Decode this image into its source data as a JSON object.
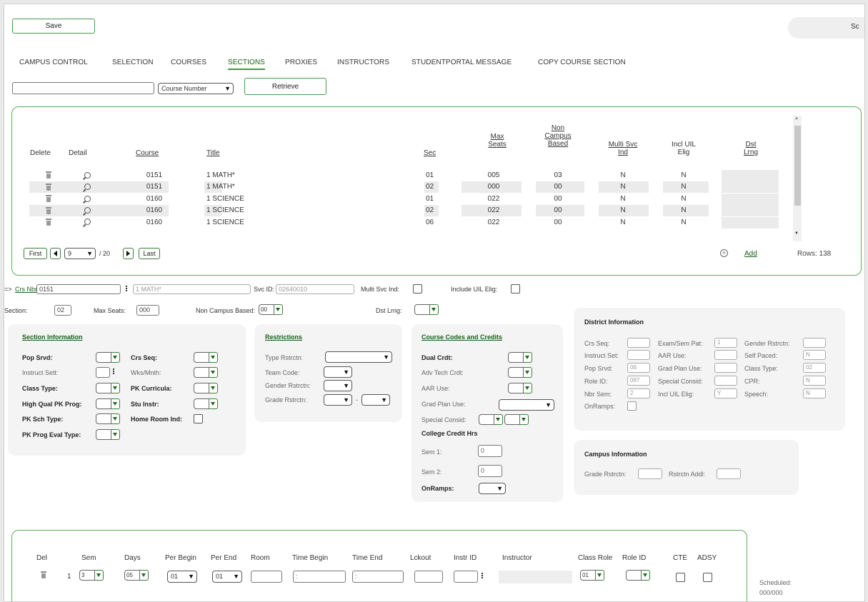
{
  "toolbar": {
    "save_label": "Save",
    "search_partial": "Sc"
  },
  "tabs": [
    {
      "label": "CAMPUS CONTROL"
    },
    {
      "label": "SELECTION"
    },
    {
      "label": "COURSES"
    },
    {
      "label": "SECTIONS"
    },
    {
      "label": "PROXIES"
    },
    {
      "label": "INSTRUCTORS"
    },
    {
      "label": "STUDENTPORTAL MESSAGE"
    },
    {
      "label": "COPY COURSE SECTION"
    }
  ],
  "retrieve": {
    "search_value": "",
    "mode_select": "Course Number",
    "button": "Retrieve"
  },
  "grid": {
    "headers": {
      "delete": "Delete",
      "detail": "Detail",
      "course": "Course",
      "title": "Title",
      "sec": "Sec",
      "max_seats_1": "Max",
      "max_seats_2": "Seats",
      "non_campus_1": "Non",
      "non_campus_2": "Campus",
      "non_campus_3": "Based",
      "multi_svc_1": "Multi Svc",
      "multi_svc_2": "Ind",
      "incl_uil_1": "Incl UIL",
      "incl_uil_2": "Elig",
      "dst_lrng_1": "Dst",
      "dst_lrng_2": "Lrng"
    },
    "rows": [
      {
        "course": "0151",
        "title": "1 MATH*",
        "sec": "01",
        "max_seats": "005",
        "non_campus": "03",
        "multi_svc": "N",
        "incl_uil": "N",
        "dst": ""
      },
      {
        "course": "0151",
        "title": "1 MATH*",
        "sec": "02",
        "max_seats": "000",
        "non_campus": "00",
        "multi_svc": "N",
        "incl_uil": "N",
        "dst": ""
      },
      {
        "course": "0160",
        "title": "1 SCIENCE",
        "sec": "01",
        "max_seats": "022",
        "non_campus": "00",
        "multi_svc": "N",
        "incl_uil": "N",
        "dst": ""
      },
      {
        "course": "0160",
        "title": "1 SCIENCE",
        "sec": "02",
        "max_seats": "022",
        "non_campus": "00",
        "multi_svc": "N",
        "incl_uil": "N",
        "dst": ""
      },
      {
        "course": "0160",
        "title": "1 SCIENCE",
        "sec": "06",
        "max_seats": "022",
        "non_campus": "00",
        "multi_svc": "N",
        "incl_uil": "N",
        "dst": ""
      }
    ],
    "pager": {
      "first": "First",
      "page": "9",
      "total": "/ 20",
      "last": "Last"
    },
    "add_label": "Add",
    "rows_count": "Rows: 138"
  },
  "detail": {
    "arrow": "=>",
    "crs_nbr_label": "Crs Nbr:",
    "crs_nbr_value": "0151",
    "title_value": "1 MATH*",
    "svc_id_label": "Svc ID:",
    "svc_id_value": "02640010",
    "multi_svc_label": "Multi Svc Ind:",
    "include_uil_label": "Include UIL Elig:",
    "section_label": "Section:",
    "section_value": "02",
    "max_seats_label": "Max Seats:",
    "max_seats_value": "000",
    "non_campus_label": "Non Campus Based:",
    "non_campus_value": "00",
    "dst_lrng_label": "Dst Lrng:"
  },
  "section_info": {
    "title": "Section Information",
    "pop_srvd": "Pop Srvd:",
    "instruct_sett": "Instruct Sett:",
    "class_type": "Class Type:",
    "high_qual": "High Qual PK Prog:",
    "pk_sch_type": "PK Sch Type:",
    "pk_prog_eval": "PK Prog Eval Type:",
    "crs_seq": "Crs Seq:",
    "wks_mnth": "Wks/Mnth:",
    "pk_curricula": "PK Curricula:",
    "stu_instr": "Stu Instr:",
    "home_room": "Home Room Ind:"
  },
  "restrictions": {
    "title": "Restrictions",
    "type_rstrctn": "Type Rstrctn:",
    "team_code": "Team Code:",
    "gender_rstrctn": "Gender Rstrctn:",
    "grade_rstrctn": "Grade Rstrctn:",
    "dash": "-"
  },
  "course_codes": {
    "title": "Course Codes and Credits",
    "dual_crdt": "Dual Crdt:",
    "adv_tech": "Adv Tech Crdt:",
    "aar_use": "AAR Use:",
    "grad_plan": "Grad Plan Use:",
    "special_consid": "Special Consid:",
    "college_credit": "College Credit Hrs",
    "sem1_label": "Sem 1:",
    "sem1_value": "0",
    "sem2_label": "Sem 2:",
    "sem2_value": "0",
    "onramps": "OnRamps:"
  },
  "district_info": {
    "title": "District Information",
    "crs_seq": "Crs Seq:",
    "crs_seq_v": "",
    "instruct_set": "Instruct Set:",
    "instruct_set_v": "",
    "pop_srvd": "Pop Srvd:",
    "pop_srvd_v": "06",
    "role_id": "Role ID:",
    "role_id_v": "087",
    "nbr_sem": "Nbr Sem:",
    "nbr_sem_v": "2",
    "onramps": "OnRamps:",
    "exam_sem": "Exam/Sem Pat:",
    "exam_sem_v": "1",
    "aar_use": "AAR Use:",
    "aar_use_v": "",
    "grad_plan": "Grad Plan Use:",
    "grad_plan_v": "",
    "special_consid": "Special Consid:",
    "special_consid_v": "",
    "incl_uil": "Incl UIL Elig:",
    "incl_uil_v": "Y",
    "gender": "Gender Rstrctn:",
    "gender_v": "",
    "self_paced": "Self Paced:",
    "self_paced_v": "N",
    "class_type": "Class Type:",
    "class_type_v": "02",
    "cpr": "CPR:",
    "cpr_v": "N",
    "speech": "Speech:",
    "speech_v": "N"
  },
  "campus_info": {
    "title": "Campus Information",
    "grade_rstrctn": "Grade Rstrctn:",
    "rstrctn_addl": "Rstrctn Addl:"
  },
  "schedule": {
    "headers": {
      "del": "Del",
      "sem": "Sem",
      "days": "Days",
      "per_begin": "Per Begin",
      "per_end": "Per End",
      "room": "Room",
      "time_begin": "Time Begin",
      "time_end": "Time End",
      "lckout": "Lckout",
      "instr_id": "Instr ID",
      "instructor": "Instructor",
      "class_role": "Class Role",
      "role_id": "Role ID",
      "cte": "CTE",
      "adsy": "ADSY"
    },
    "row": {
      "num": "1",
      "sem": "3",
      "days": "05",
      "per_begin": "01",
      "per_end": "01",
      "time_begin": ":",
      "time_end": ":",
      "class_role": "01"
    },
    "scheduled_label": "Scheduled:",
    "scheduled_value": "000/000"
  },
  "colors": {
    "accent_green": "#4a9a4a",
    "link_green": "#1a5e1a"
  }
}
